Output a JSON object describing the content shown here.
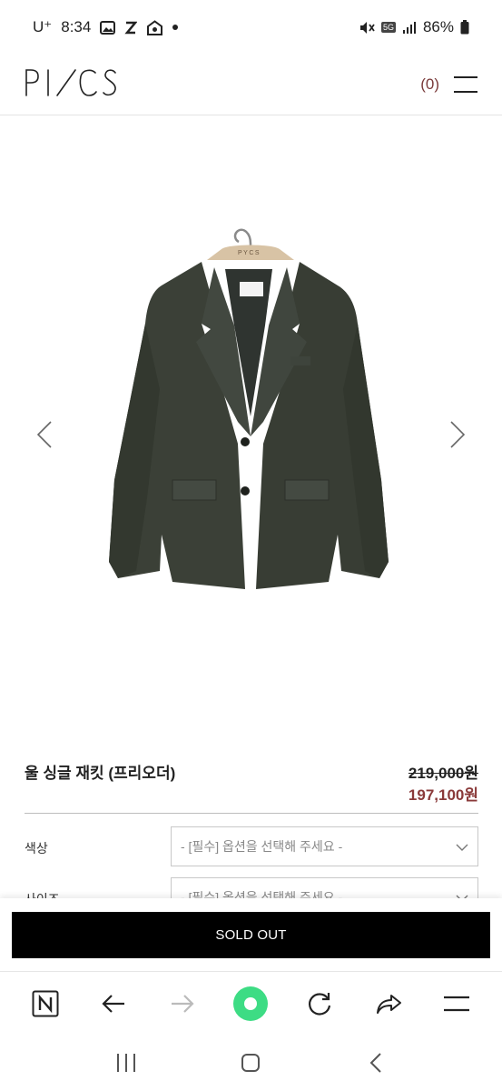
{
  "status_bar": {
    "carrier": "U⁺",
    "time": "8:34",
    "app_icons": [
      "gallery-icon",
      "z-icon",
      "home-camera-icon"
    ],
    "battery": "86%",
    "network": "5G"
  },
  "header": {
    "logo": "PYCS",
    "cart_count": "(0)"
  },
  "gallery": {
    "hanger_tag": "PYCS"
  },
  "product": {
    "name": "울 싱글 재킷 (프리오더)",
    "original_price": "219,000원",
    "sale_price": "197,100원"
  },
  "options": [
    {
      "label": "색상",
      "placeholder": "- [필수] 옵션을 선택해 주세요 -"
    },
    {
      "label": "사이즈",
      "placeholder": "- [필수] 옵션을 선택해 주세요 -"
    }
  ],
  "actions": {
    "sold_out_label": "SOLD OUT"
  },
  "colors": {
    "accent_price": "#8a3a3a",
    "sold_out_bg": "#000000",
    "refresh_green": "#3ddc84"
  }
}
